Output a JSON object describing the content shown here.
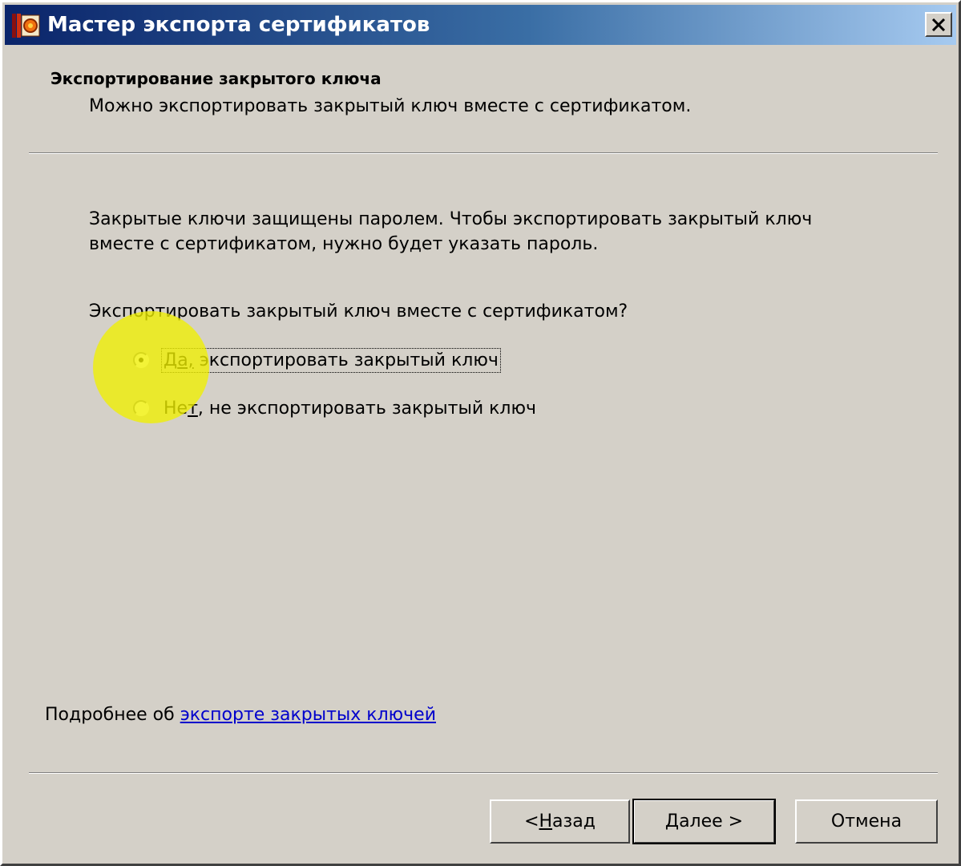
{
  "window": {
    "title": "Мастер экспорта сертификатов",
    "close_icon": "close-icon"
  },
  "header": {
    "title": "Экспортирование закрытого ключа",
    "subtitle": "Можно экспортировать закрытый ключ вместе с сертификатом."
  },
  "body": {
    "description_line1": "Закрытые ключи защищены паролем. Чтобы экспортировать закрытый ключ",
    "description_line2": "вместе с сертификатом, нужно будет указать пароль.",
    "question": "Экспортировать закрытый ключ вместе с сертификатом?",
    "options": [
      {
        "accel": "Д",
        "rest_focused": "а,",
        "rest": " экспортировать закрытый ключ",
        "selected": true
      },
      {
        "before": "Не",
        "accel": "т",
        "rest": ", не экспортировать закрытый ключ",
        "selected": false
      }
    ]
  },
  "footer": {
    "more_prefix": "Подробнее об ",
    "more_link": "экспорте закрытых ключей"
  },
  "buttons": {
    "back_prefix": "< ",
    "back_accel": "Н",
    "back_rest": "азад",
    "next_accel": "Д",
    "next_rest": "алее >",
    "cancel": "Отмена"
  },
  "colors": {
    "face": "#d4d0c8",
    "title_gradient_start": "#0a246a",
    "title_gradient_end": "#a6caf0",
    "link": "#0000cc",
    "highlight": "#f0f000"
  }
}
